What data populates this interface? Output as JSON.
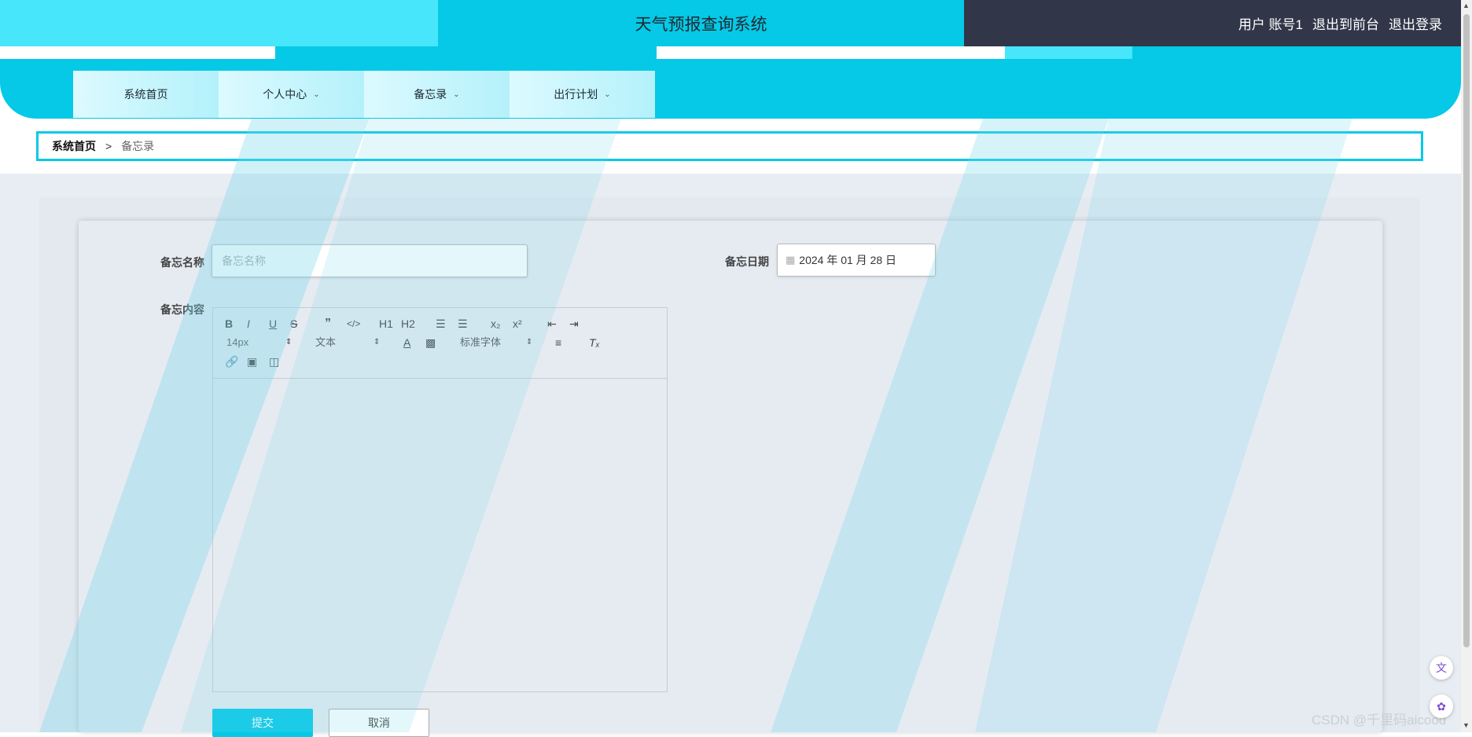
{
  "header": {
    "title": "天气预报查询系统",
    "user_label": "用户 账号1",
    "back_to_front": "退出到前台",
    "logout": "退出登录"
  },
  "nav": {
    "items": [
      {
        "label": "系统首页",
        "has_dropdown": false
      },
      {
        "label": "个人中心",
        "has_dropdown": true
      },
      {
        "label": "备忘录",
        "has_dropdown": true
      },
      {
        "label": "出行计划",
        "has_dropdown": true
      }
    ]
  },
  "breadcrumb": {
    "home": "系统首页",
    "separator": ">",
    "current": "备忘录"
  },
  "form": {
    "name_label": "备忘名称",
    "name_placeholder": "备忘名称",
    "date_label": "备忘日期",
    "date_value": "2024 年 01 月 28 日",
    "content_label": "备忘内容",
    "submit": "提交",
    "cancel": "取消"
  },
  "editor": {
    "font_size": "14px",
    "block_type": "文本",
    "font_family": "标准字体",
    "buttons": {
      "bold": "B",
      "italic": "I",
      "underline": "U",
      "strike": "S",
      "h1": "H1",
      "h2": "H2",
      "sub": "x₂",
      "sup": "x²"
    }
  },
  "watermark": "CSDN @千里码aicood",
  "colors": {
    "accent": "#05c9e6",
    "accent_light": "#47e6fb",
    "header_dark": "#313649"
  }
}
